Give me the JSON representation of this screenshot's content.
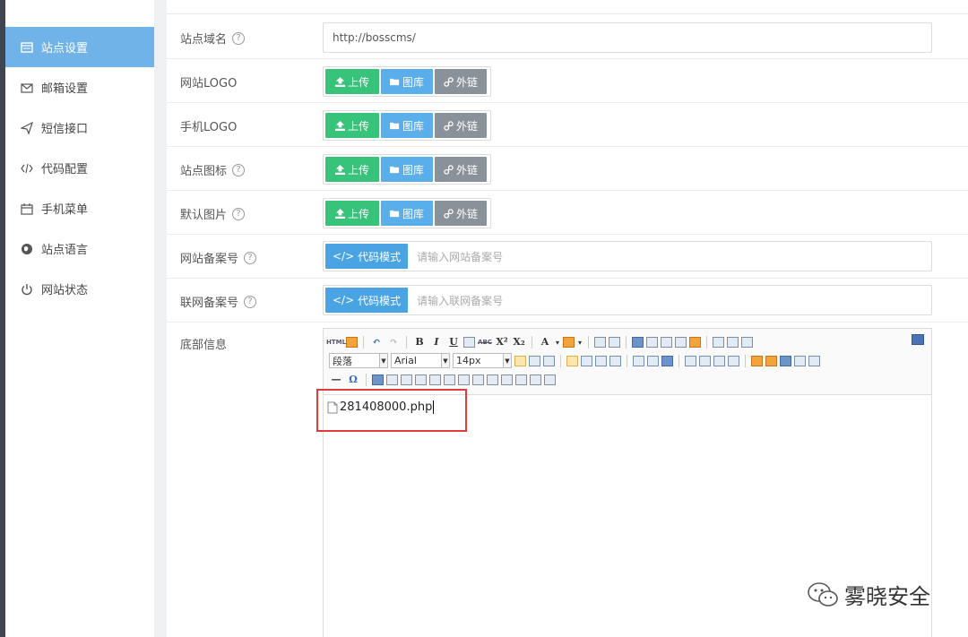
{
  "sidebar": {
    "items": [
      {
        "label": "站点设置",
        "icon": "layout-icon",
        "active": true
      },
      {
        "label": "邮箱设置",
        "icon": "mail-icon",
        "active": false
      },
      {
        "label": "短信接口",
        "icon": "send-icon",
        "active": false
      },
      {
        "label": "代码配置",
        "icon": "code-icon",
        "active": false
      },
      {
        "label": "手机菜单",
        "icon": "calendar-icon",
        "active": false
      },
      {
        "label": "站点语言",
        "icon": "globe-icon",
        "active": false
      },
      {
        "label": "网站状态",
        "icon": "power-icon",
        "active": false
      }
    ]
  },
  "form": {
    "domain": {
      "label": "站点域名",
      "value": "http://bosscms/"
    },
    "logo": {
      "label": "网站LOGO"
    },
    "mobile_logo": {
      "label": "手机LOGO"
    },
    "favicon": {
      "label": "站点图标"
    },
    "default_image": {
      "label": "默认图片"
    },
    "icp": {
      "label": "网站备案号",
      "placeholder": "请输入网站备案号"
    },
    "police": {
      "label": "联网备案号",
      "placeholder": "请输入联网备案号"
    },
    "footer": {
      "label": "底部信息"
    }
  },
  "buttons": {
    "upload": "上传",
    "gallery": "图库",
    "external": "外链",
    "code_mode": "代码模式"
  },
  "editor": {
    "paragraph": "段落",
    "font": "Arial",
    "size": "14px",
    "content_file": "281408000.php",
    "toolbar_glyphs": {
      "html": "HTML",
      "bold": "B",
      "italic": "I",
      "underline": "U",
      "strike": "ABC",
      "superscript": "X²",
      "subscript": "X₂",
      "font_color": "A",
      "omega": "Ω"
    }
  },
  "watermark": {
    "text": "雾晓安全"
  },
  "colors": {
    "active_nav": "#6fb3e9",
    "upload": "#38c37a",
    "gallery": "#5aaee9",
    "external": "#8a9299",
    "code": "#4aa3e3",
    "highlight": "#e23b3b"
  }
}
